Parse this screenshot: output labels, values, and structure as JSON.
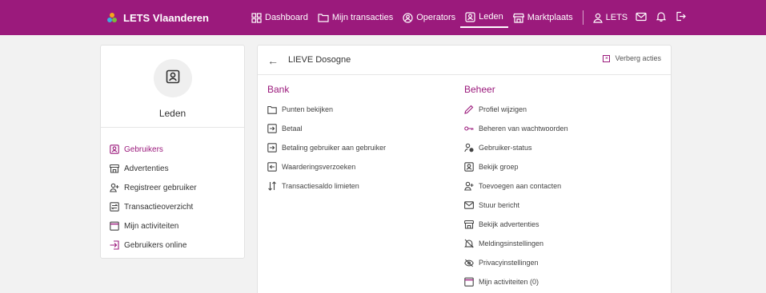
{
  "colors": {
    "brand": "#9b1a7c",
    "accent": "#9b1a7c",
    "logo": [
      "#f3a71c",
      "#3aaee0",
      "#7cbc3a"
    ]
  },
  "brand": {
    "title": "LETS Vlaanderen"
  },
  "nav": {
    "items": [
      {
        "label": "Dashboard",
        "icon": "dashboard-icon"
      },
      {
        "label": "Mijn transacties",
        "icon": "folder-icon"
      },
      {
        "label": "Operators",
        "icon": "operators-icon"
      },
      {
        "label": "Leden",
        "icon": "member-icon"
      },
      {
        "label": "Marktplaats",
        "icon": "market-icon"
      }
    ],
    "user_label": "LETS",
    "right_icons": [
      "mail-icon",
      "bell-icon",
      "logout-icon"
    ]
  },
  "left": {
    "title": "Leden",
    "menu": [
      {
        "label": "Gebruikers",
        "icon": "member-icon"
      },
      {
        "label": "Advertenties",
        "icon": "market-icon"
      },
      {
        "label": "Registreer gebruiker",
        "icon": "user-add-icon"
      },
      {
        "label": "Transactieoverzicht",
        "icon": "transfer-icon"
      },
      {
        "label": "Mijn activiteiten",
        "icon": "calendar-icon"
      },
      {
        "label": "Gebruikers online",
        "icon": "login-icon"
      }
    ]
  },
  "main": {
    "title": "LIEVE Dosogne",
    "hide_actions_label": "Verberg acties",
    "bank": {
      "title": "Bank",
      "items": [
        {
          "label": "Punten bekijken",
          "icon": "folder-icon"
        },
        {
          "label": "Betaal",
          "icon": "arrow-box-icon"
        },
        {
          "label": "Betaling gebruiker aan gebruiker",
          "icon": "arrow-box-icon"
        },
        {
          "label": "Waarderingsverzoeken",
          "icon": "arrow-box-left-icon"
        },
        {
          "label": "Transactiesaldo limieten",
          "icon": "up-down-arrows-icon"
        }
      ]
    },
    "beheer": {
      "title": "Beheer",
      "items": [
        {
          "label": "Profiel wijzigen",
          "icon": "pencil-icon"
        },
        {
          "label": "Beheren van wachtwoorden",
          "icon": "key-icon"
        },
        {
          "label": "Gebruiker-status",
          "icon": "user-status-icon"
        },
        {
          "label": "Bekijk groep",
          "icon": "member-icon"
        },
        {
          "label": "Toevoegen aan contacten",
          "icon": "user-add-icon"
        },
        {
          "label": "Stuur bericht",
          "icon": "mail-icon"
        },
        {
          "label": "Bekijk advertenties",
          "icon": "market-icon"
        },
        {
          "label": "Meldingsinstellingen",
          "icon": "bell-off-icon"
        },
        {
          "label": "Privacyinstellingen",
          "icon": "eye-off-icon"
        },
        {
          "label": "Mijn activiteiten (0)",
          "icon": "calendar-icon"
        }
      ]
    }
  }
}
